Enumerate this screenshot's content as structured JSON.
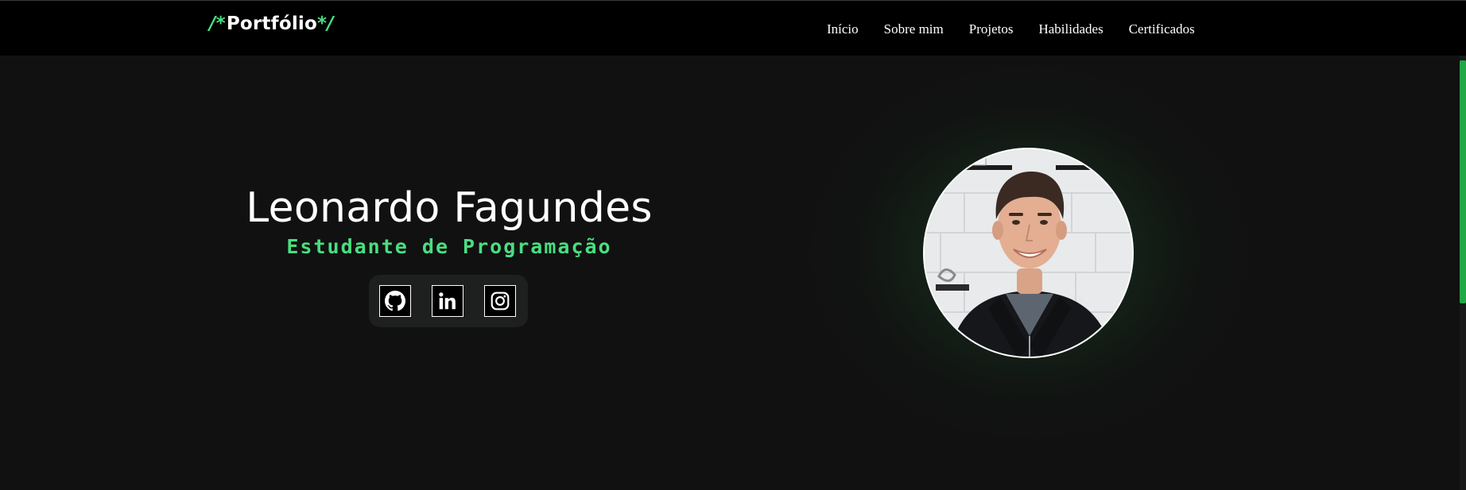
{
  "header": {
    "logo_prefix": "/*",
    "logo_text": "Portfólio",
    "logo_suffix": "*/",
    "nav": [
      {
        "label": "Início"
      },
      {
        "label": "Sobre mim"
      },
      {
        "label": "Projetos"
      },
      {
        "label": "Habilidades"
      },
      {
        "label": "Certificados"
      }
    ]
  },
  "hero": {
    "name": "Leonardo Fagundes",
    "role": "Estudante de Programação",
    "socials": [
      {
        "icon": "github-icon"
      },
      {
        "icon": "linkedin-icon"
      },
      {
        "icon": "instagram-icon"
      }
    ],
    "photo_alt": "profile-photo"
  },
  "colors": {
    "accent": "#4ade80",
    "background": "#111111",
    "navbar": "#000000",
    "scrollbar": "#22a845"
  },
  "scroll": {
    "position": 0
  }
}
